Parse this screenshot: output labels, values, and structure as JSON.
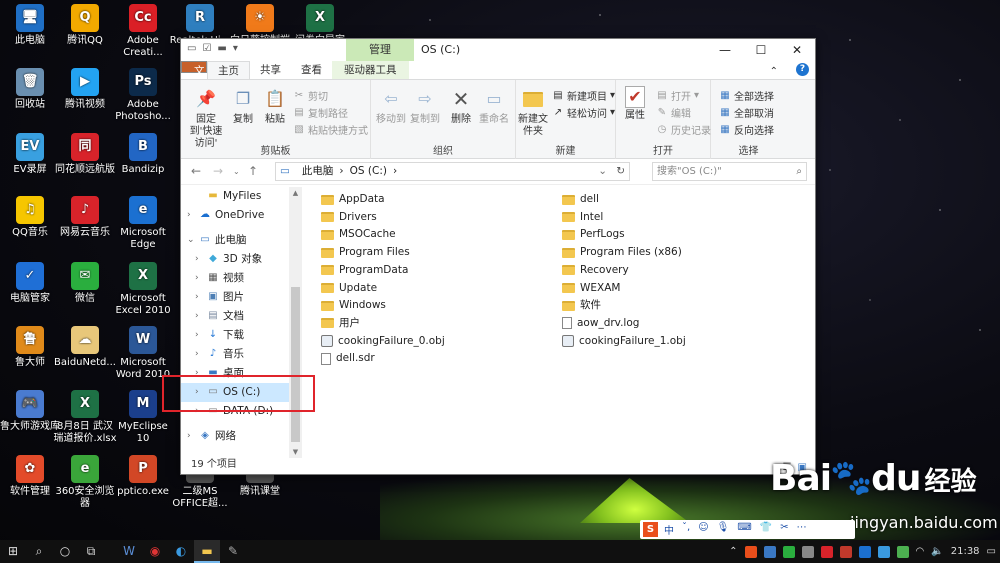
{
  "desktop": {
    "icons": [
      {
        "label": "此电脑",
        "glyph": "🖥",
        "color": "#1f6fc5"
      },
      {
        "label": "腾讯QQ",
        "glyph": "Q",
        "color": "#f2a900"
      },
      {
        "label": "Adobe Creati...",
        "glyph": "Cc",
        "color": "#da1f26"
      },
      {
        "label": "Realtek Hi...",
        "glyph": "R",
        "color": "#2f7fbf"
      },
      {
        "label": "向日葵控制端",
        "glyph": "☀",
        "color": "#f07a1a"
      },
      {
        "label": "问卷向导家",
        "glyph": "X",
        "color": "#1e7145"
      },
      {
        "label": "回收站",
        "glyph": "🗑",
        "color": "#6a8fb0"
      },
      {
        "label": "腾讯视频",
        "glyph": "▶",
        "color": "#23a3f2"
      },
      {
        "label": "Adobe Photosho...",
        "glyph": "Ps",
        "color": "#0c2a4a"
      },
      {
        "label": "EV录屏",
        "glyph": "EV",
        "color": "#39a0e0"
      },
      {
        "label": "同花顺远航版",
        "glyph": "同",
        "color": "#d8232a"
      },
      {
        "label": "Bandizip",
        "glyph": "B",
        "color": "#2266c4"
      },
      {
        "label": "QQ音乐",
        "glyph": "♫",
        "color": "#f6c600"
      },
      {
        "label": "网易云音乐",
        "glyph": "♪",
        "color": "#d8232a"
      },
      {
        "label": "Microsoft Edge",
        "glyph": "e",
        "color": "#1b70d1"
      },
      {
        "label": "电脑管家",
        "glyph": "✓",
        "color": "#1f6fd6"
      },
      {
        "label": "微信",
        "glyph": "✉",
        "color": "#2aae3e"
      },
      {
        "label": "Microsoft Excel 2010",
        "glyph": "X",
        "color": "#1e7145"
      },
      {
        "label": "鲁大师",
        "glyph": "鲁",
        "color": "#e08a1a"
      },
      {
        "label": "BaiduNetd...",
        "glyph": "☁",
        "color": "#e8c77a"
      },
      {
        "label": "Microsoft Word 2010",
        "glyph": "W",
        "color": "#2b5797"
      },
      {
        "label": "鲁大师游戏库",
        "glyph": "🎮",
        "color": "#4a7bd0"
      },
      {
        "label": "8月8日 武汉瑞道报价.xlsx",
        "glyph": "X",
        "color": "#1e7145"
      },
      {
        "label": "MyEclipse 10",
        "glyph": "M",
        "color": "#1b3f8c"
      },
      {
        "label": "软件管理",
        "glyph": "✿",
        "color": "#e34b2a"
      },
      {
        "label": "360安全浏览器",
        "glyph": "e",
        "color": "#3aa63a"
      },
      {
        "label": "pptico.exe",
        "glyph": "P",
        "color": "#d24726"
      },
      {
        "label": "二级MS OFFICE超...",
        "glyph": "",
        "color": "#555"
      },
      {
        "label": "腾讯课堂",
        "glyph": "",
        "color": "#555"
      }
    ]
  },
  "explorer": {
    "title": "OS (C:)",
    "context_tab": "管理",
    "window_buttons": {
      "minimize": "—",
      "maximize": "☐",
      "close": "✕"
    },
    "tabs": {
      "file": "文件",
      "home": "主页",
      "share": "共享",
      "view": "查看",
      "drive_tools": "驱动器工具"
    },
    "help_caret": "⌃",
    "help": "?",
    "ribbon": {
      "clipboard": {
        "label": "剪贴板",
        "pin": "固定到'快速访问'",
        "copy": "复制",
        "paste": "粘贴",
        "cut": "剪切",
        "copy_path": "复制路径",
        "paste_shortcut": "粘贴快捷方式"
      },
      "organize": {
        "label": "组织",
        "move_to": "移动到",
        "copy_to": "复制到",
        "delete": "删除",
        "rename": "重命名"
      },
      "new": {
        "label": "新建",
        "new_folder": "新建文件夹",
        "new_item": "新建项目",
        "easy_access": "轻松访问"
      },
      "open": {
        "label": "打开",
        "properties": "属性",
        "open": "打开",
        "edit": "编辑",
        "history": "历史记录"
      },
      "select": {
        "label": "选择",
        "select_all": "全部选择",
        "select_none": "全部取消",
        "invert": "反向选择"
      }
    },
    "address": {
      "pc": "此电脑",
      "drive": "OS (C:)",
      "sep": "›"
    },
    "search_placeholder": "搜索\"OS (C:)\"",
    "nav": [
      {
        "label": "MyFiles",
        "icon": "folder",
        "level": 1,
        "expand": ""
      },
      {
        "label": "OneDrive",
        "icon": "cloud",
        "level": 0,
        "expand": "›"
      },
      {
        "label": "此电脑",
        "icon": "pc",
        "level": 0,
        "expand": "⌄"
      },
      {
        "label": "3D 对象",
        "icon": "cube",
        "level": 1,
        "expand": "›"
      },
      {
        "label": "视频",
        "icon": "film",
        "level": 1,
        "expand": "›"
      },
      {
        "label": "图片",
        "icon": "pic",
        "level": 1,
        "expand": "›"
      },
      {
        "label": "文档",
        "icon": "doc",
        "level": 1,
        "expand": "›"
      },
      {
        "label": "下载",
        "icon": "down",
        "level": 1,
        "expand": "›"
      },
      {
        "label": "音乐",
        "icon": "music",
        "level": 1,
        "expand": "›"
      },
      {
        "label": "桌面",
        "icon": "desk",
        "level": 1,
        "expand": "›"
      },
      {
        "label": "OS (C:)",
        "icon": "drive",
        "level": 1,
        "expand": "›",
        "selected": true
      },
      {
        "label": "DATA (D:)",
        "icon": "drive",
        "level": 1,
        "expand": "›"
      },
      {
        "label": "网络",
        "icon": "net",
        "level": 0,
        "expand": "›"
      }
    ],
    "files_left": [
      {
        "name": "AppData",
        "type": "folder"
      },
      {
        "name": "Drivers",
        "type": "folder"
      },
      {
        "name": "MSOCache",
        "type": "folder"
      },
      {
        "name": "Program Files",
        "type": "folder"
      },
      {
        "name": "ProgramData",
        "type": "folder"
      },
      {
        "name": "Update",
        "type": "folder"
      },
      {
        "name": "Windows",
        "type": "folder"
      },
      {
        "name": "用户",
        "type": "folder"
      },
      {
        "name": "cookingFailure_0.obj",
        "type": "obj"
      },
      {
        "name": "dell.sdr",
        "type": "file"
      }
    ],
    "files_right": [
      {
        "name": "dell",
        "type": "folder"
      },
      {
        "name": "Intel",
        "type": "folder"
      },
      {
        "name": "PerfLogs",
        "type": "folder"
      },
      {
        "name": "Program Files (x86)",
        "type": "folder"
      },
      {
        "name": "Recovery",
        "type": "folder"
      },
      {
        "name": "WEXAM",
        "type": "folder"
      },
      {
        "name": "软件",
        "type": "folder"
      },
      {
        "name": "aow_drv.log",
        "type": "file"
      },
      {
        "name": "cookingFailure_1.obj",
        "type": "obj"
      }
    ],
    "status": "19 个项目"
  },
  "watermark": {
    "brand": "Bai",
    "brand2": "du",
    "text": "经验",
    "url": "jingyan.baidu.com"
  },
  "ime": {
    "logo": "S",
    "items": [
      "中",
      "ˇ,",
      "☺",
      "🎙",
      "⌨",
      "👕",
      "✂",
      "⋯"
    ]
  },
  "taskbar": {
    "time": "21:38"
  },
  "colors": {
    "file_tab": "#c7602a",
    "selection": "#cce8ff",
    "highlight_box": "#e0242b",
    "context_tab": "#cbe9b7"
  }
}
